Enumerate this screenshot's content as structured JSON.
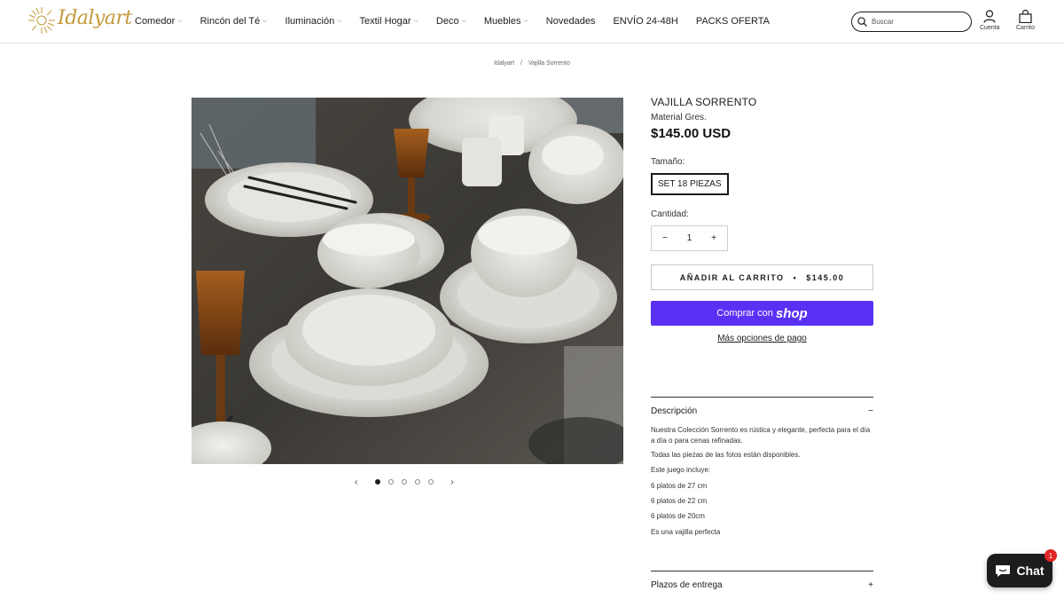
{
  "brand": {
    "logo_text": "Idalyart",
    "accent": "#c49a3a"
  },
  "nav": [
    {
      "label": "Comedor",
      "has_menu": true
    },
    {
      "label": "Rincón del Té",
      "has_menu": true
    },
    {
      "label": "Iluminación",
      "has_menu": true
    },
    {
      "label": "Textil Hogar",
      "has_menu": true
    },
    {
      "label": "Deco",
      "has_menu": true
    },
    {
      "label": "Muebles",
      "has_menu": true
    },
    {
      "label": "Novedades",
      "has_menu": false
    },
    {
      "label": "ENVÍO 24-48H",
      "has_menu": false
    },
    {
      "label": "PACKS OFERTA",
      "has_menu": false
    }
  ],
  "search": {
    "placeholder": "Buscar"
  },
  "header_icons": {
    "account": "Cuenta",
    "cart": "Carrito"
  },
  "breadcrumb": {
    "home": "Idalyart",
    "current": "Vajilla Sorrento"
  },
  "carousel": {
    "total": 5,
    "active": 1
  },
  "product": {
    "title": "VAJILLA SORRENTO",
    "subtitle": "Material Gres.",
    "price": "$145.00 USD",
    "size_label": "Tamaño:",
    "size_option": "SET 18 PIEZAS",
    "qty_label": "Cantidad:",
    "qty_value": "1",
    "add_to_cart": "AÑADIR AL CARRITO",
    "add_to_cart_price": "$145.00",
    "shop_pay_prefix": "Comprar con",
    "shop_pay_logo": "shop",
    "shop_pay_color": "#5a31f4",
    "more_payment": "Más opciones de pago"
  },
  "description": {
    "heading": "Descripción",
    "lines": [
      "Nuestra Colección Sorrento es rústica y elegante, perfecta para el día a día o para cenas refinadas.",
      "Todas las piezas de las fotos están disponibles.",
      "Este juego incluye:",
      "6 platos de 27 cm",
      "6 platos de 22 cm",
      "6 platos de 20cm",
      "Es una vajilla perfecta"
    ]
  },
  "delivery": {
    "heading": "Plazos de entrega"
  },
  "chat": {
    "label": "Chat",
    "badge": "1"
  }
}
